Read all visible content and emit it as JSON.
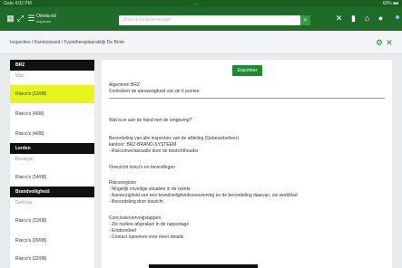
{
  "statusbar": {
    "left": "Gate 4:02 PM",
    "mid": "....",
    "right": "68% ■■"
  },
  "appbar": {
    "brand_line1": "Omnia ed",
    "brand_line2": "Inspector",
    "search_placeholder": "Zoek in ondernemingen",
    "icons": [
      "grid-icon",
      "expand-icon",
      "menu-icon",
      "search-icon",
      "tools-icon",
      "clipboard-icon",
      "user-icon"
    ]
  },
  "breadcrumb": {
    "text": "Inspecties / Kantoorpand / Fysiotherapiepraktijk De Brink"
  },
  "sidebar": {
    "items": [
      {
        "type": "head",
        "label": "BRZ"
      },
      {
        "type": "sub",
        "label": "Wat"
      },
      {
        "type": "link",
        "label": "Risico's (12/08)",
        "active": true
      },
      {
        "type": "link",
        "label": "Risico's (4/08)"
      },
      {
        "type": "link",
        "label": "Risico's (4/08)"
      },
      {
        "type": "head",
        "label": "Lerden"
      },
      {
        "type": "sub",
        "label": "Bezorgin"
      },
      {
        "type": "link",
        "label": "Risico's (14/08)"
      },
      {
        "type": "head",
        "label": "Brandveiligheid"
      },
      {
        "type": "sub",
        "label": "Gebouw"
      },
      {
        "type": "link",
        "label": "Risico's (13/08)"
      },
      {
        "type": "link",
        "label": "Risico's (29/08)"
      },
      {
        "type": "link",
        "label": "Risico's (22/08)"
      }
    ]
  },
  "content": {
    "button_label": "Exporteer",
    "heading_line1": "Algemeen BRZ",
    "heading_line2": "Controleer de aanwezigheid van de 6 punten",
    "intro": "Wat is er aan de hand met de omgeving?",
    "block1": [
      "Beoordeling van alle inspecties van de afdeling (Gebouwbeheer)",
      "kantoor: BRZ-BRAND-SYSTEEM",
      "- Risicoinventarisatie door de toezichthouder"
    ],
    "subheading": "Overzicht risico's en bevindingen",
    "block2": [
      "Risicoregister",
      "- Mogelijk onveilige situaties in de ruimte",
      "- Aanwezigheid van een brandveiligheidsvoorziening en de beoordeling daarvan, zie werkblad",
      "- Beoordeling door toezicht"
    ],
    "block3": [
      "Conclusie/vervolgstappen",
      "- Zie nadere afspraken in de rapportage",
      "- Eindoordeel",
      "- Contact opnemen voor meer details"
    ]
  }
}
